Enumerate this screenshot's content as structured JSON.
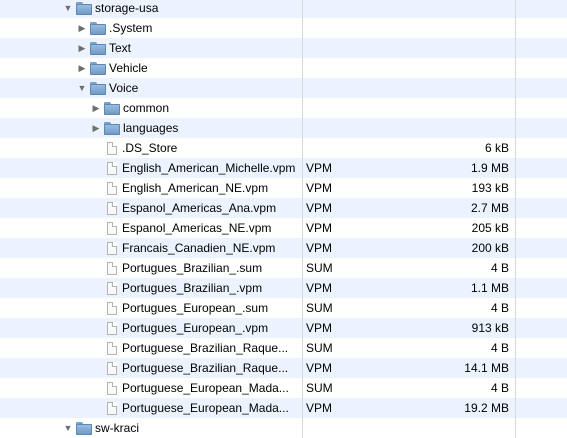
{
  "rows": [
    {
      "name": "storage-usa",
      "type": "folder",
      "level": 0,
      "expanded": true,
      "kind": "",
      "size": ""
    },
    {
      "name": ".System",
      "type": "folder",
      "level": 1,
      "expanded": false,
      "kind": "",
      "size": ""
    },
    {
      "name": "Text",
      "type": "folder",
      "level": 1,
      "expanded": false,
      "kind": "",
      "size": ""
    },
    {
      "name": "Vehicle",
      "type": "folder",
      "level": 1,
      "expanded": false,
      "kind": "",
      "size": ""
    },
    {
      "name": "Voice",
      "type": "folder",
      "level": 1,
      "expanded": true,
      "kind": "",
      "size": ""
    },
    {
      "name": "common",
      "type": "folder",
      "level": 2,
      "expanded": false,
      "kind": "",
      "size": ""
    },
    {
      "name": "languages",
      "type": "folder",
      "level": 2,
      "expanded": false,
      "kind": "",
      "size": ""
    },
    {
      "name": ".DS_Store",
      "type": "file",
      "level": 2,
      "kind": "",
      "size": "6 kB"
    },
    {
      "name": "English_American_Michelle.vpm",
      "type": "file",
      "level": 2,
      "kind": "VPM",
      "size": "1.9 MB"
    },
    {
      "name": "English_American_NE.vpm",
      "type": "file",
      "level": 2,
      "kind": "VPM",
      "size": "193 kB"
    },
    {
      "name": "Espanol_Americas_Ana.vpm",
      "type": "file",
      "level": 2,
      "kind": "VPM",
      "size": "2.7 MB"
    },
    {
      "name": "Espanol_Americas_NE.vpm",
      "type": "file",
      "level": 2,
      "kind": "VPM",
      "size": "205 kB"
    },
    {
      "name": "Francais_Canadien_NE.vpm",
      "type": "file",
      "level": 2,
      "kind": "VPM",
      "size": "200 kB"
    },
    {
      "name": "Portugues_Brazilian_.sum",
      "type": "file",
      "level": 2,
      "kind": "SUM",
      "size": "4 B"
    },
    {
      "name": "Portugues_Brazilian_.vpm",
      "type": "file",
      "level": 2,
      "kind": "VPM",
      "size": "1.1 MB"
    },
    {
      "name": "Portugues_European_.sum",
      "type": "file",
      "level": 2,
      "kind": "SUM",
      "size": "4 B"
    },
    {
      "name": "Portugues_European_.vpm",
      "type": "file",
      "level": 2,
      "kind": "VPM",
      "size": "913 kB"
    },
    {
      "name": "Portuguese_Brazilian_Raque...",
      "type": "file",
      "level": 2,
      "kind": "SUM",
      "size": "4 B"
    },
    {
      "name": "Portuguese_Brazilian_Raque...",
      "type": "file",
      "level": 2,
      "kind": "VPM",
      "size": "14.1 MB"
    },
    {
      "name": "Portuguese_European_Mada...",
      "type": "file",
      "level": 2,
      "kind": "SUM",
      "size": "4 B"
    },
    {
      "name": "Portuguese_European_Mada...",
      "type": "file",
      "level": 2,
      "kind": "VPM",
      "size": "19.2 MB"
    },
    {
      "name": "sw-kraci",
      "type": "folder",
      "level": 0,
      "expanded": true,
      "kind": "",
      "size": ""
    }
  ]
}
